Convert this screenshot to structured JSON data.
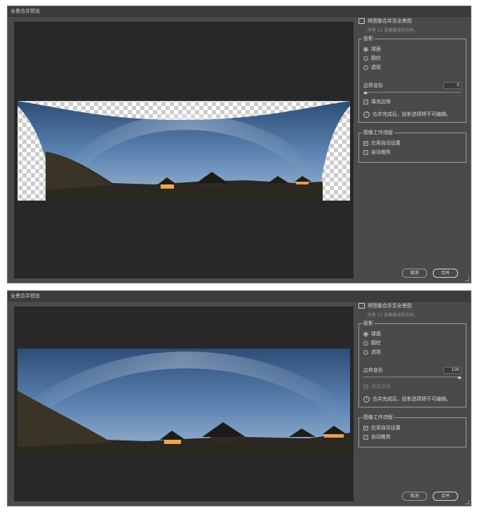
{
  "dialog1": {
    "title": "全景合并预览",
    "header": "将图像合并至全景图",
    "subtitle": "所有 11 张图像成功合并。",
    "projection_legend": "投影",
    "projections": [
      "球面",
      "圆柱",
      "透视"
    ],
    "selected_projection": "球面",
    "boundary_label": "边界变形",
    "boundary_value": "0",
    "boundary_level": 0,
    "fill_edges_label": "填充边缘",
    "fill_edges_checked": false,
    "info_text": "合并完成后，投影选项将不可编辑。",
    "workflow_legend": "图像工作流程",
    "apply_auto_label": "应用自动设置",
    "apply_auto_checked": true,
    "auto_crop_label": "自动裁剪",
    "auto_crop_checked": false,
    "cancel_label": "取消",
    "merge_label": "合并"
  },
  "dialog2": {
    "title": "全景合并预览",
    "header": "将图像合并至全景图",
    "subtitle": "所有 11 张图像成功合并。",
    "projection_legend": "投影",
    "projections": [
      "球面",
      "圆柱",
      "透视"
    ],
    "selected_projection": "球面",
    "boundary_label": "边界变形",
    "boundary_value": "100",
    "boundary_level": 100,
    "fill_edges_label": "填充边缘",
    "fill_edges_checked": false,
    "info_text": "合并完成后，投影选项将不可编辑。",
    "workflow_legend": "图像工作流程",
    "apply_auto_label": "应用自动设置",
    "apply_auto_checked": true,
    "auto_crop_label": "自动裁剪",
    "auto_crop_checked": false,
    "cancel_label": "取消",
    "merge_label": "合并"
  },
  "colors": {
    "dialog_bg": "#4a4a4a",
    "canvas_bg": "#282828",
    "sky_top": "#3a5f8f",
    "sky_horizon": "#8fb0cf",
    "ground": "#2c2a20",
    "light": "#ffb54a"
  },
  "icons": [
    "panorama-icon",
    "info-icon",
    "check-icon",
    "resize-grip-icon"
  ]
}
